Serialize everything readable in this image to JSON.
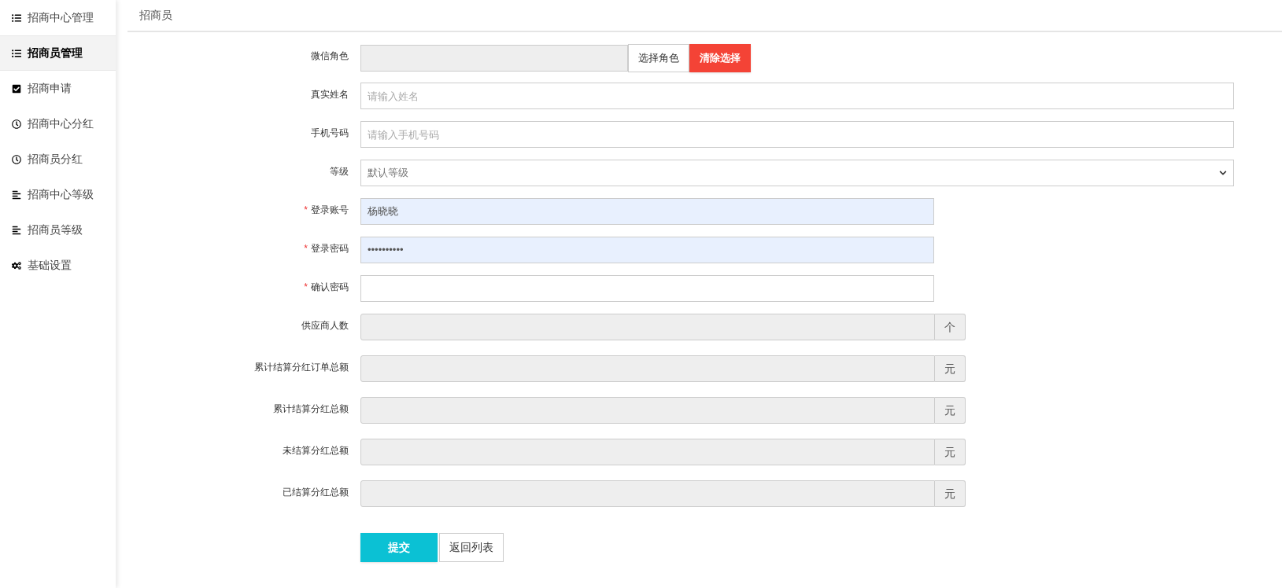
{
  "sidebar": {
    "items": [
      {
        "label": "招商中心管理",
        "selected": false
      },
      {
        "label": "招商员管理",
        "selected": true
      },
      {
        "label": "招商申请",
        "selected": false
      },
      {
        "label": "招商中心分红",
        "selected": false
      },
      {
        "label": "招商员分红",
        "selected": false
      },
      {
        "label": "招商中心等级",
        "selected": false
      },
      {
        "label": "招商员等级",
        "selected": false
      },
      {
        "label": "基础设置",
        "selected": false
      }
    ]
  },
  "header": {
    "title": "招商员"
  },
  "form": {
    "fields": [
      {
        "kind": "role",
        "label": "微信角色",
        "readonly": true,
        "buttons": [
          {
            "label": "选择角色",
            "kind": "default"
          },
          {
            "label": "清除选择",
            "kind": "danger"
          }
        ]
      },
      {
        "kind": "text",
        "label": "真实姓名",
        "readonly": false,
        "placeholder": "请输入姓名"
      },
      {
        "kind": "text",
        "label": "手机号码",
        "readonly": false,
        "placeholder": "请输入手机号码"
      },
      {
        "kind": "select",
        "label": "等级",
        "value": "默认等级"
      },
      {
        "kind": "login",
        "label": "登录账号",
        "required_mark": "*",
        "readonly": false,
        "autofilled": true,
        "value": "杨晓晓"
      },
      {
        "kind": "login",
        "label": "登录密码",
        "required_mark": "*",
        "readonly": false,
        "autofilled": true,
        "value": "••••••••••"
      },
      {
        "kind": "login",
        "label": "确认密码",
        "required_mark": "*",
        "readonly": false,
        "autofilled": false
      },
      {
        "kind": "addon",
        "label": "供应商人数",
        "readonly": true,
        "unit": "个"
      },
      {
        "kind": "addon",
        "label": "累计结算分红订单总额",
        "readonly": true,
        "unit": "元"
      },
      {
        "kind": "addon",
        "label": "累计结算分红总额",
        "readonly": true,
        "unit": "元"
      },
      {
        "kind": "addon",
        "label": "未结算分红总额",
        "readonly": true,
        "unit": "元"
      },
      {
        "kind": "addon",
        "label": "已结算分红总额",
        "readonly": true,
        "unit": "元"
      }
    ],
    "actions": [
      {
        "label": "提交",
        "kind": "primary"
      },
      {
        "label": "返回列表",
        "kind": "default"
      }
    ]
  }
}
